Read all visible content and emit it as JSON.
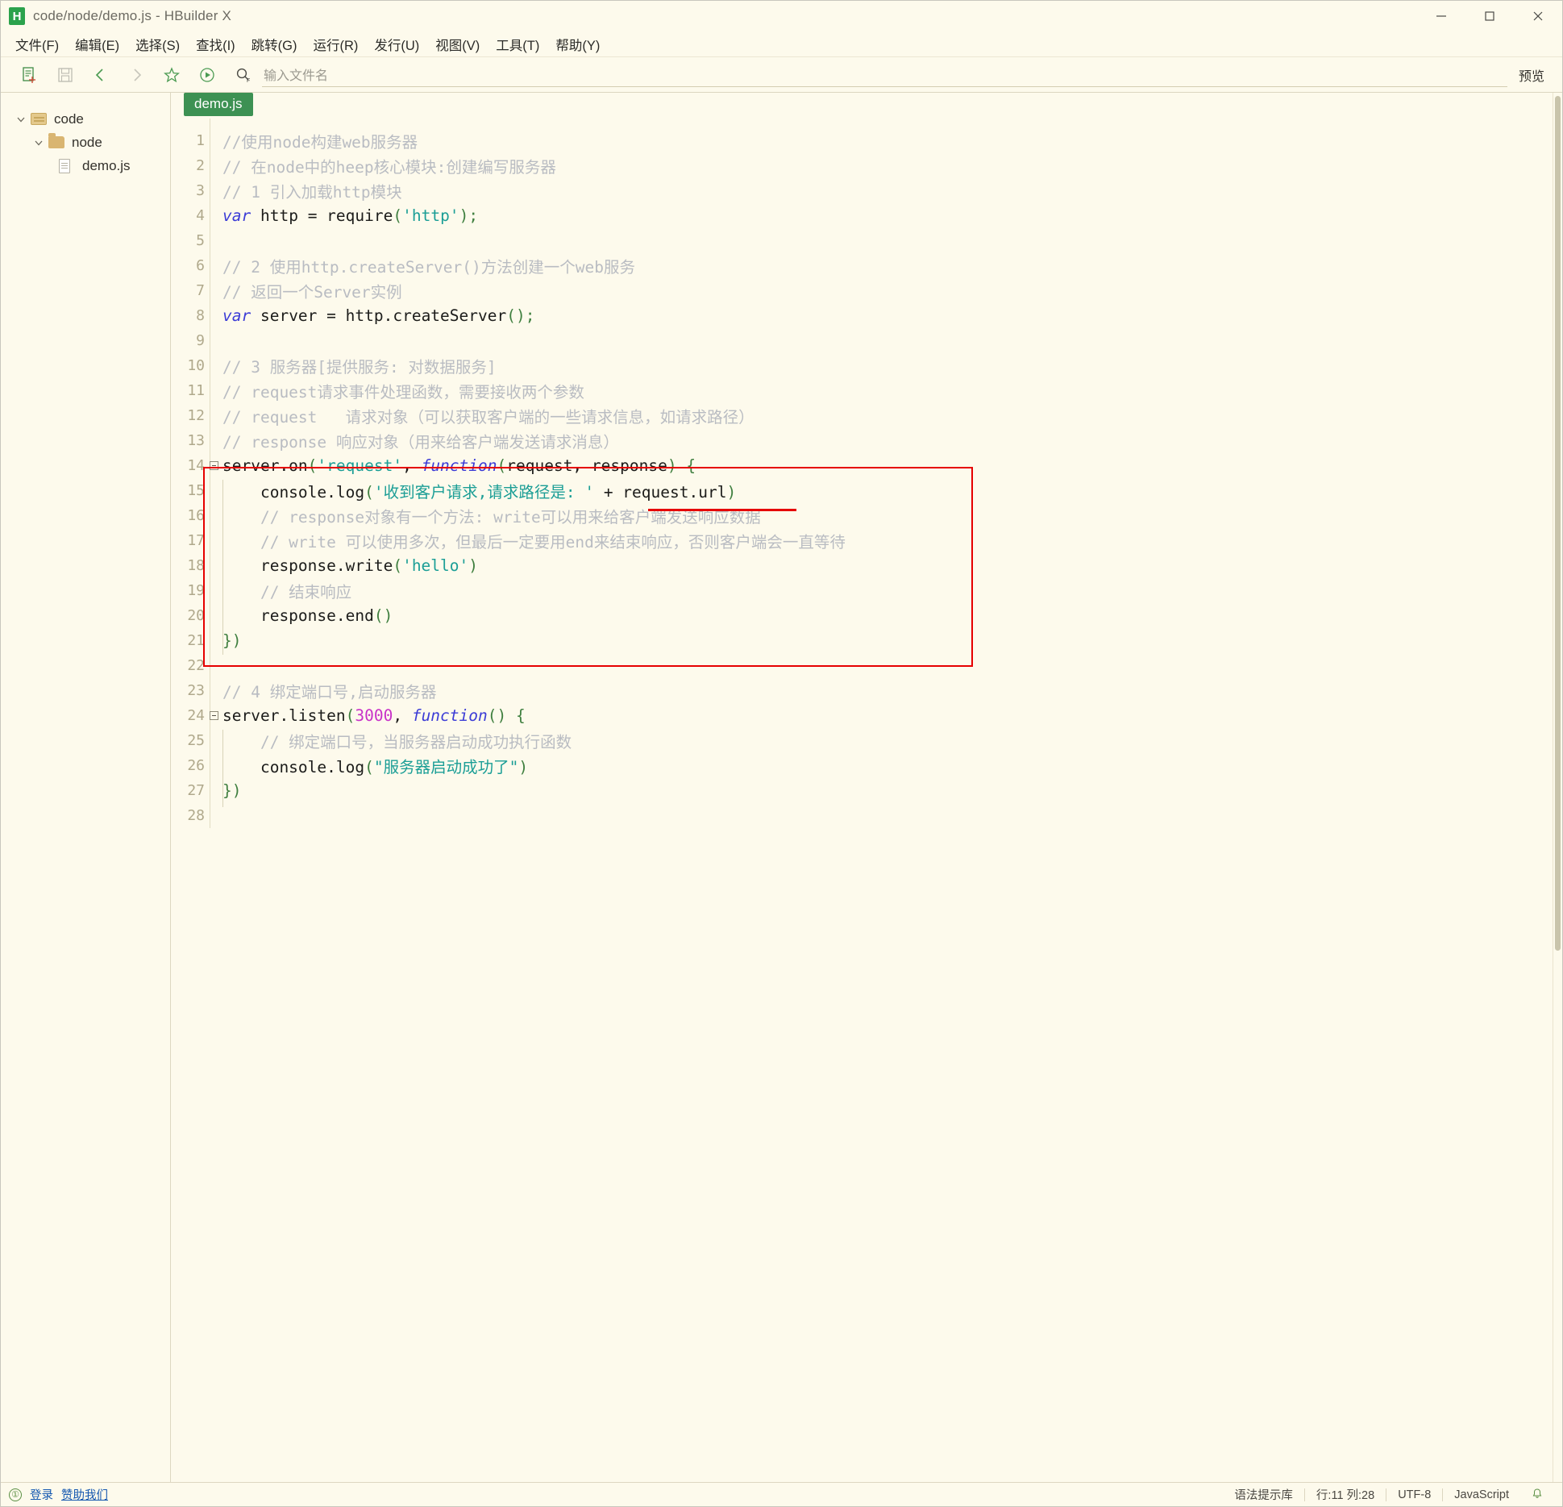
{
  "window": {
    "title": "code/node/demo.js - HBuilder X",
    "logo_icon": "hbuilder-logo-icon",
    "controls": [
      {
        "name": "minimize-button",
        "icon": "minimize-icon"
      },
      {
        "name": "maximize-button",
        "icon": "maximize-icon"
      },
      {
        "name": "close-button",
        "icon": "close-icon"
      }
    ]
  },
  "menubar": {
    "items": [
      {
        "label": "文件(F)",
        "name": "menu-file"
      },
      {
        "label": "编辑(E)",
        "name": "menu-edit"
      },
      {
        "label": "选择(S)",
        "name": "menu-select"
      },
      {
        "label": "查找(I)",
        "name": "menu-find"
      },
      {
        "label": "跳转(G)",
        "name": "menu-goto"
      },
      {
        "label": "运行(R)",
        "name": "menu-run"
      },
      {
        "label": "发行(U)",
        "name": "menu-publish"
      },
      {
        "label": "视图(V)",
        "name": "menu-view"
      },
      {
        "label": "工具(T)",
        "name": "menu-tools"
      },
      {
        "label": "帮助(Y)",
        "name": "menu-help"
      }
    ]
  },
  "toolbar": {
    "icons": [
      {
        "name": "new-file-icon"
      },
      {
        "name": "save-icon"
      },
      {
        "name": "back-icon"
      },
      {
        "name": "forward-icon"
      },
      {
        "name": "favorite-star-icon"
      },
      {
        "name": "run-icon"
      }
    ],
    "search": {
      "icon": "search-file-icon",
      "placeholder": "输入文件名",
      "value": ""
    },
    "preview_label": "预览"
  },
  "sidebar": {
    "tree": [
      {
        "label": "code",
        "level": 0,
        "icon": "folder-open-icon",
        "expanded": true
      },
      {
        "label": "node",
        "level": 1,
        "icon": "folder-closed-icon",
        "expanded": true
      },
      {
        "label": "demo.js",
        "level": 2,
        "icon": "file-icon",
        "expanded": null
      }
    ]
  },
  "editor": {
    "tab_label": "demo.js",
    "lines": [
      {
        "n": "1",
        "fold": false,
        "tokens": [
          {
            "t": "//使用node构建web服务器",
            "c": "cm"
          }
        ]
      },
      {
        "n": "2",
        "fold": false,
        "tokens": [
          {
            "t": "// 在node中的heep核心模块:创建编写服务器",
            "c": "cm"
          }
        ]
      },
      {
        "n": "3",
        "fold": false,
        "tokens": [
          {
            "t": "// 1 引入加载http模块",
            "c": "cm"
          }
        ]
      },
      {
        "n": "4",
        "fold": false,
        "tokens": [
          {
            "t": "var",
            "c": "kw"
          },
          {
            "t": " http ",
            "c": "pl"
          },
          {
            "t": "=",
            "c": "pl"
          },
          {
            "t": " require",
            "c": "pl"
          },
          {
            "t": "(",
            "c": "pn"
          },
          {
            "t": "'http'",
            "c": "str"
          },
          {
            "t": ")",
            "c": "pn"
          },
          {
            "t": ";",
            "c": "pn"
          }
        ]
      },
      {
        "n": "5",
        "fold": false,
        "tokens": []
      },
      {
        "n": "6",
        "fold": false,
        "tokens": [
          {
            "t": "// 2 使用http.createServer()方法创建一个web服务",
            "c": "cm"
          }
        ]
      },
      {
        "n": "7",
        "fold": false,
        "tokens": [
          {
            "t": "// 返回一个Server实例",
            "c": "cm"
          }
        ]
      },
      {
        "n": "8",
        "fold": false,
        "tokens": [
          {
            "t": "var",
            "c": "kw"
          },
          {
            "t": " server ",
            "c": "pl"
          },
          {
            "t": "=",
            "c": "pl"
          },
          {
            "t": " http.createServer",
            "c": "pl"
          },
          {
            "t": "()",
            "c": "pn"
          },
          {
            "t": ";",
            "c": "pn"
          }
        ]
      },
      {
        "n": "9",
        "fold": false,
        "tokens": []
      },
      {
        "n": "10",
        "fold": false,
        "tokens": [
          {
            "t": "// 3 服务器[提供服务: 对数据服务]",
            "c": "cm"
          }
        ]
      },
      {
        "n": "11",
        "fold": false,
        "tokens": [
          {
            "t": "// request请求事件处理函数，需要接收两个参数",
            "c": "cm"
          }
        ]
      },
      {
        "n": "12",
        "fold": false,
        "tokens": [
          {
            "t": "// request   请求对象（可以获取客户端的一些请求信息，如请求路径）",
            "c": "cm"
          }
        ]
      },
      {
        "n": "13",
        "fold": false,
        "tokens": [
          {
            "t": "// response 响应对象（用来给客户端发送请求消息）",
            "c": "cm"
          }
        ]
      },
      {
        "n": "14",
        "fold": true,
        "tokens": [
          {
            "t": "server.on",
            "c": "pl"
          },
          {
            "t": "(",
            "c": "pn"
          },
          {
            "t": "'request'",
            "c": "str"
          },
          {
            "t": ", ",
            "c": "pl"
          },
          {
            "t": "function",
            "c": "kw"
          },
          {
            "t": "(",
            "c": "pn"
          },
          {
            "t": "request, response",
            "c": "pl"
          },
          {
            "t": ")",
            "c": "pn"
          },
          {
            "t": " ",
            "c": "pl"
          },
          {
            "t": "{",
            "c": "pn"
          }
        ]
      },
      {
        "n": "15",
        "fold": false,
        "tokens": [
          {
            "t": "    console.log",
            "c": "pl"
          },
          {
            "t": "(",
            "c": "pn"
          },
          {
            "t": "'收到客户请求,请求路径是: '",
            "c": "str"
          },
          {
            "t": " ",
            "c": "pl"
          },
          {
            "t": "+",
            "c": "pl"
          },
          {
            "t": " request.url",
            "c": "pl"
          },
          {
            "t": ")",
            "c": "pn"
          }
        ]
      },
      {
        "n": "16",
        "fold": false,
        "tokens": [
          {
            "t": "    // response对象有一个方法: write可以用来给客户端发送响应数据",
            "c": "cm"
          }
        ]
      },
      {
        "n": "17",
        "fold": false,
        "tokens": [
          {
            "t": "    // write 可以使用多次，但最后一定要用end来结束响应，否则客户端会一直等待",
            "c": "cm"
          }
        ]
      },
      {
        "n": "18",
        "fold": false,
        "tokens": [
          {
            "t": "    response.write",
            "c": "pl"
          },
          {
            "t": "(",
            "c": "pn"
          },
          {
            "t": "'hello'",
            "c": "str"
          },
          {
            "t": ")",
            "c": "pn"
          }
        ]
      },
      {
        "n": "19",
        "fold": false,
        "tokens": [
          {
            "t": "    // 结束响应",
            "c": "cm"
          }
        ]
      },
      {
        "n": "20",
        "fold": false,
        "tokens": [
          {
            "t": "    response.end",
            "c": "pl"
          },
          {
            "t": "()",
            "c": "pn"
          }
        ]
      },
      {
        "n": "21",
        "fold": false,
        "tokens": [
          {
            "t": "})",
            "c": "pn"
          }
        ]
      },
      {
        "n": "22",
        "fold": false,
        "tokens": []
      },
      {
        "n": "23",
        "fold": false,
        "tokens": [
          {
            "t": "// 4 绑定端口号,启动服务器",
            "c": "cm"
          }
        ]
      },
      {
        "n": "24",
        "fold": true,
        "tokens": [
          {
            "t": "server.listen",
            "c": "pl"
          },
          {
            "t": "(",
            "c": "pn"
          },
          {
            "t": "3000",
            "c": "num"
          },
          {
            "t": ", ",
            "c": "pl"
          },
          {
            "t": "function",
            "c": "kw"
          },
          {
            "t": "()",
            "c": "pn"
          },
          {
            "t": " ",
            "c": "pl"
          },
          {
            "t": "{",
            "c": "pn"
          }
        ]
      },
      {
        "n": "25",
        "fold": false,
        "tokens": [
          {
            "t": "    // 绑定端口号，当服务器启动成功执行函数",
            "c": "cm"
          }
        ]
      },
      {
        "n": "26",
        "fold": false,
        "tokens": [
          {
            "t": "    console.log",
            "c": "pl"
          },
          {
            "t": "(",
            "c": "pn"
          },
          {
            "t": "\"服务器启动成功了\"",
            "c": "str"
          },
          {
            "t": ")",
            "c": "pn"
          }
        ]
      },
      {
        "n": "27",
        "fold": false,
        "tokens": [
          {
            "t": "})",
            "c": "pn"
          }
        ]
      },
      {
        "n": "28",
        "fold": false,
        "tokens": []
      }
    ]
  },
  "annotations": {
    "box_color": "#e60000",
    "box_note": "red rectangle around lines 14-21",
    "underline_note": "red underline under + request.url)"
  },
  "statusbar": {
    "login_icon": "account-icon",
    "login_label": "登录",
    "donate_label": "赞助我们",
    "syntax_hint": "语法提示库",
    "cursor": "行:11 列:28",
    "encoding": "UTF-8",
    "language": "JavaScript",
    "bell_icon": "bell-icon"
  }
}
